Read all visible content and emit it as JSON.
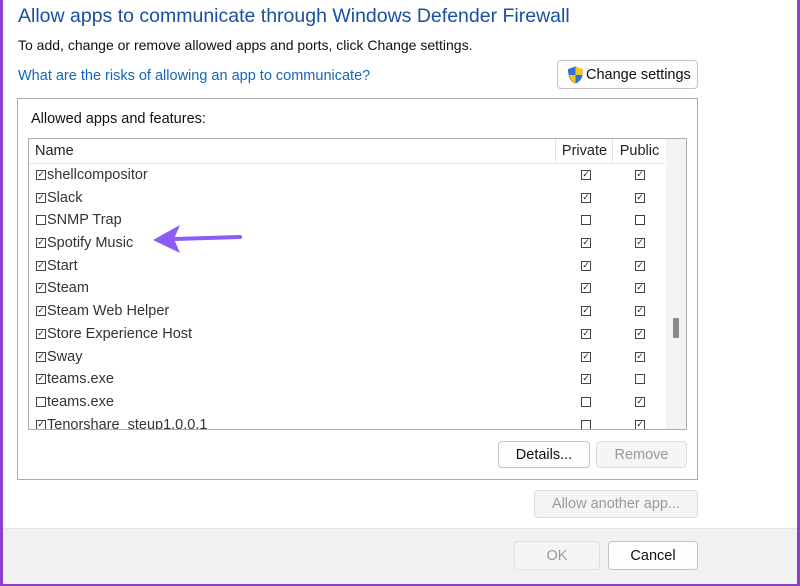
{
  "dialog": {
    "title": "Allow apps to communicate through Windows Defender Firewall",
    "subtitle": "To add, change or remove allowed apps and ports, click Change settings.",
    "risk_link": "What are the risks of allowing an app to communicate?",
    "change_settings": "Change settings"
  },
  "list": {
    "group_label": "Allowed apps and features:",
    "columns": {
      "name": "Name",
      "private": "Private",
      "public": "Public"
    },
    "rows": [
      {
        "name": "shellcompositor",
        "enabled": true,
        "private": true,
        "public": true
      },
      {
        "name": "Slack",
        "enabled": true,
        "private": true,
        "public": true
      },
      {
        "name": "SNMP Trap",
        "enabled": false,
        "private": false,
        "public": false
      },
      {
        "name": "Spotify Music",
        "enabled": true,
        "private": true,
        "public": true
      },
      {
        "name": "Start",
        "enabled": true,
        "private": true,
        "public": true
      },
      {
        "name": "Steam",
        "enabled": true,
        "private": true,
        "public": true
      },
      {
        "name": "Steam Web Helper",
        "enabled": true,
        "private": true,
        "public": true
      },
      {
        "name": "Store Experience Host",
        "enabled": true,
        "private": true,
        "public": true
      },
      {
        "name": "Sway",
        "enabled": true,
        "private": true,
        "public": true
      },
      {
        "name": "teams.exe",
        "enabled": true,
        "private": true,
        "public": false
      },
      {
        "name": "teams.exe",
        "enabled": false,
        "private": false,
        "public": true
      },
      {
        "name": "Tenorshare_steup1.0.0.1",
        "enabled": true,
        "private": false,
        "public": true
      }
    ]
  },
  "buttons": {
    "details": "Details...",
    "remove": "Remove",
    "allow_another": "Allow another app...",
    "ok": "OK",
    "cancel": "Cancel"
  },
  "icons": {
    "shield": "uac-shield-icon",
    "arrow": "annotation-arrow-icon"
  },
  "colors": {
    "accent": "#1a4fa3",
    "link": "#1466b8",
    "annotation": "#8b5cf6",
    "frame": "#8f3fd0"
  }
}
